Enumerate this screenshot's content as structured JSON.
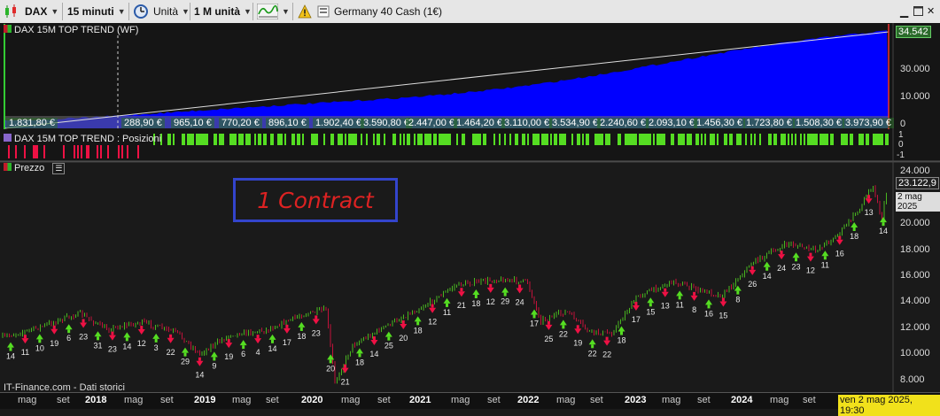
{
  "toolbar": {
    "symbol": "DAX",
    "timeframe": "15 minuti",
    "units_label": "Unità",
    "period": "1 M unità",
    "instrument": "Germany 40 Cash (1€)"
  },
  "equity_panel": {
    "title": "DAX 15M TOP TREND (WF)",
    "last_value": "34.542",
    "y_ticks": [
      "30.000",
      "20.000",
      "10.000",
      "0"
    ],
    "pnl_labels": [
      "1.831,80 €",
      "288,90 €",
      "965,10 €",
      "770,20 €",
      "896,10 €",
      "1.902,40 €",
      "3.590,80 €",
      "2.447,00 €",
      "1.464,20 €",
      "3.110,00 €",
      "3.534,90 €",
      "2.240,60 €",
      "2.093,10 €",
      "1.456,30 €",
      "1.723,80 €",
      "1.508,30 €",
      "3.973,90 €"
    ]
  },
  "positions_panel": {
    "title": "DAX 15M TOP TREND : Posizioni",
    "y_ticks": [
      "1",
      "0",
      "-1"
    ]
  },
  "price_panel": {
    "title": "Prezzo",
    "annotation": "1 Contract",
    "last_price": "23.122,9",
    "last_date": "2 mag 2025",
    "y_ticks": [
      "24.000",
      "22.000",
      "20.000",
      "18.000",
      "16.000",
      "14.000",
      "12.000",
      "10.000",
      "8.000"
    ],
    "source": "IT-Finance.com - Dati storici",
    "trade_labels": [
      "14",
      "11",
      "10",
      "19",
      "6",
      "23",
      "31",
      "23",
      "14",
      "12",
      "3",
      "22",
      "29",
      "14",
      "9",
      "19",
      "6",
      "4",
      "14",
      "17",
      "18",
      "23",
      "20",
      "21",
      "18",
      "14",
      "25",
      "20",
      "18",
      "12",
      "11",
      "21",
      "18",
      "12",
      "29",
      "24",
      "17",
      "25",
      "22",
      "19",
      "22",
      "22",
      "18",
      "17",
      "15",
      "13",
      "11",
      "8",
      "16",
      "15",
      "8",
      "26",
      "14",
      "24",
      "23",
      "12",
      "11",
      "16",
      "18",
      "13",
      "14"
    ]
  },
  "x_axis": {
    "labels": [
      "mag",
      "set",
      "2018",
      "mag",
      "set",
      "2019",
      "mag",
      "set",
      "2020",
      "mag",
      "set",
      "2021",
      "mag",
      "set",
      "2022",
      "mag",
      "set",
      "2023",
      "mag",
      "set",
      "2024",
      "mag",
      "set"
    ],
    "cursor_label": "ven 2 mag 2025, 19:30"
  },
  "colors": {
    "equity_fill": "#0000ff",
    "long": "#55dd22",
    "short": "#ee1144",
    "annotation_border": "#3344cc",
    "annotation_text": "#dd2222"
  }
}
